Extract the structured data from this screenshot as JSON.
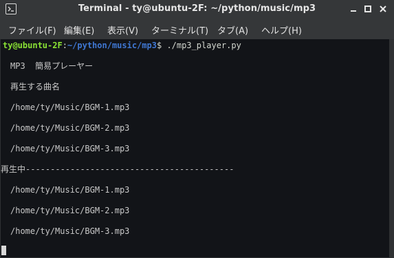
{
  "window": {
    "title": "Terminal - ty@ubuntu-2F: ~/python/music/mp3"
  },
  "menu": {
    "file": "ファイル(F)",
    "edit": "編集(E)",
    "view": "表示(V)",
    "terminal": "ターミナル(T)",
    "tabs": "タブ(A)",
    "help": "ヘルプ(H)"
  },
  "terminal": {
    "prompt_user": "ty@ubuntu-2F",
    "prompt_sep": ":",
    "prompt_path": "~/python/music/mp3",
    "prompt_symbol": "$",
    "command": " ./mp3_player.py",
    "lines": [
      "MP3  簡易プレーヤー",
      "再生する曲名",
      "/home/ty/Music/BGM-1.mp3",
      "/home/ty/Music/BGM-2.mp3",
      "/home/ty/Music/BGM-3.mp3",
      "再生中------------------------------------------",
      "/home/ty/Music/BGM-1.mp3",
      "/home/ty/Music/BGM-2.mp3",
      "/home/ty/Music/BGM-3.mp3"
    ]
  },
  "icons": {
    "app": "terminal-icon",
    "minimize": "minimize-icon",
    "maximize": "maximize-icon",
    "close": "close-icon"
  }
}
